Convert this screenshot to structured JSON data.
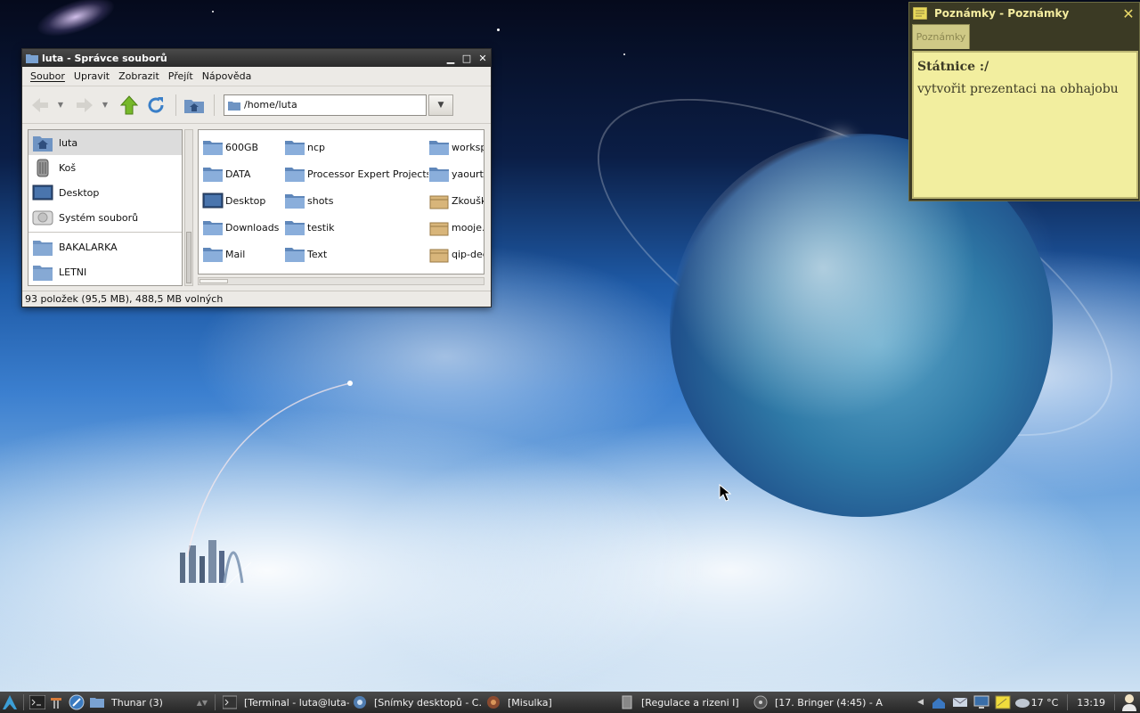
{
  "file_manager": {
    "title": "luta - Správce souborů",
    "menu": [
      "Soubor",
      "Upravit",
      "Zobrazit",
      "Přejít",
      "Nápověda"
    ],
    "location": "/home/luta",
    "sidebar": [
      {
        "label": "luta",
        "icon": "home-folder-icon",
        "selected": true
      },
      {
        "label": "Koš",
        "icon": "trash-icon"
      },
      {
        "label": "Desktop",
        "icon": "desktop-icon"
      },
      {
        "label": "Systém souborů",
        "icon": "drive-icon"
      },
      {
        "label": "BAKALARKA",
        "icon": "folder-icon"
      },
      {
        "label": "LETNI",
        "icon": "folder-icon"
      }
    ],
    "files": [
      {
        "label": "600GB",
        "icon": "folder-icon"
      },
      {
        "label": "ncp",
        "icon": "folder-icon"
      },
      {
        "label": "worksp",
        "icon": "folder-icon"
      },
      {
        "label": "DATA",
        "icon": "folder-icon"
      },
      {
        "label": "Processor Expert Projects",
        "icon": "folder-icon"
      },
      {
        "label": "yaourt",
        "icon": "folder-icon"
      },
      {
        "label": "Desktop",
        "icon": "desktop-icon"
      },
      {
        "label": "shots",
        "icon": "folder-icon"
      },
      {
        "label": "Zkoušk",
        "icon": "package-icon"
      },
      {
        "label": "Downloads",
        "icon": "folder-icon"
      },
      {
        "label": "testik",
        "icon": "folder-icon"
      },
      {
        "label": "mooje.t",
        "icon": "package-icon"
      },
      {
        "label": "Mail",
        "icon": "folder-icon"
      },
      {
        "label": "Text",
        "icon": "folder-icon"
      },
      {
        "label": "qip-dec",
        "icon": "package-icon"
      }
    ],
    "status": "93 položek (95,5 MB), 488,5 MB volných"
  },
  "notes": {
    "title": "Poznámky - Poznámky",
    "tab": "Poznámky",
    "lines": [
      "Státnice :/",
      "vytvořit prezentaci na obhajobu"
    ]
  },
  "taskbar": {
    "tasks": [
      {
        "label": "Thunar (3)",
        "icon": "folder-icon"
      },
      {
        "label": "[Terminal - luta@luta-...",
        "icon": "terminal-icon"
      },
      {
        "label": "[Snímky desktopů - C...",
        "icon": "browser-icon"
      },
      {
        "label": "[Misulka]",
        "icon": "chat-icon"
      },
      {
        "label": "[Regulace a rizeni I]",
        "icon": "document-icon"
      },
      {
        "label": "[17. Bringer (4:45) - A...",
        "icon": "music-icon"
      }
    ],
    "weather": "17 °C",
    "clock": "13:19"
  },
  "colors": {
    "window_title_bg": "#333333",
    "window_bg": "#eceae6",
    "folder_blue": "#6b95c9",
    "note_yellow": "#f2ee9f",
    "taskbar_bg": "#333333"
  }
}
